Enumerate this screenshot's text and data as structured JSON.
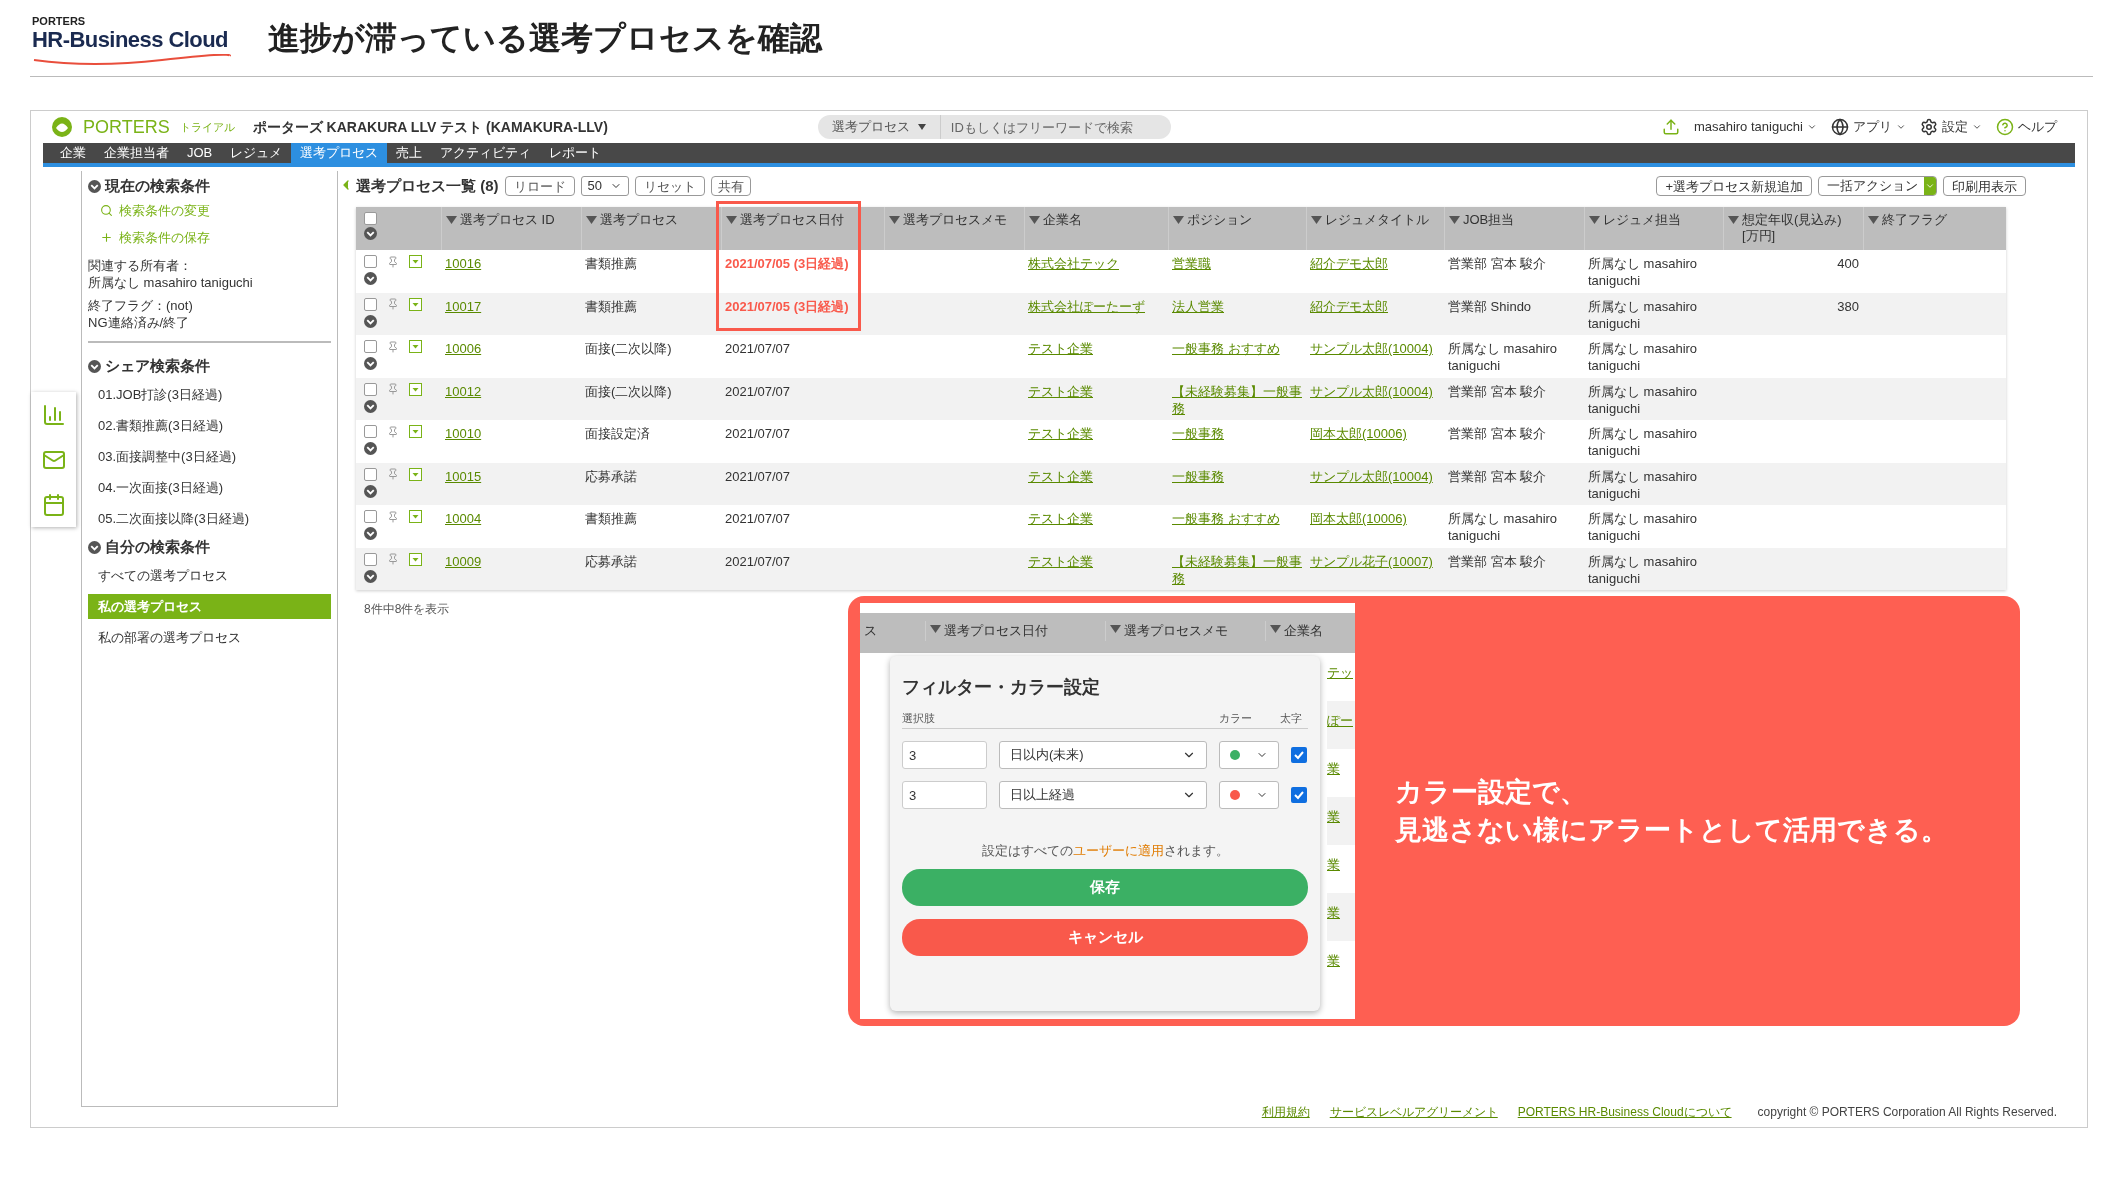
{
  "slide": {
    "logo_top": "PORTERS",
    "logo_main": "HR-Business Cloud",
    "title": "進捗が滞っている選考プロセスを確認"
  },
  "app": {
    "brand": "PORTERS",
    "trial": "トライアル",
    "account": "ポーターズ KARAKURA LLV テスト (KAMAKURA-LLV)",
    "search_scope": "選考プロセス",
    "search_placeholder": "IDもしくはフリーワードで検索",
    "user": "masahiro taniguchi",
    "menus": [
      {
        "kind": "apps",
        "label": "アプリ"
      },
      {
        "kind": "settings",
        "label": "設定"
      },
      {
        "kind": "help",
        "label": "ヘルプ"
      }
    ]
  },
  "nav": [
    {
      "label": "企業",
      "selected": false
    },
    {
      "label": "企業担当者",
      "selected": false
    },
    {
      "label": "JOB",
      "selected": false
    },
    {
      "label": "レジュメ",
      "selected": false
    },
    {
      "label": "選考プロセス",
      "selected": true
    },
    {
      "label": "売上",
      "selected": false
    },
    {
      "label": "アクティビティ",
      "selected": false
    },
    {
      "label": "レポート",
      "selected": false
    }
  ],
  "sidebar": {
    "current": {
      "heading": "現在の検索条件",
      "actions": [
        {
          "kind": "search",
          "label": "検索条件の変更"
        },
        {
          "kind": "add",
          "label": "検索条件の保存"
        }
      ],
      "conditions": [
        [
          "関連する所有者：",
          "所属なし masahiro taniguchi"
        ],
        [
          "終了フラグ：(not)",
          "NG連絡済み/終了"
        ]
      ]
    },
    "shared": {
      "heading": "シェア検索条件",
      "items": [
        {
          "label": "01.JOB打診(3日経過)",
          "selected": false
        },
        {
          "label": "02.書類推薦(3日経過)",
          "selected": false
        },
        {
          "label": "03.面接調整中(3日経過)",
          "selected": false
        },
        {
          "label": "04.一次面接(3日経過)",
          "selected": false
        },
        {
          "label": "05.二次面接以降(3日経過)",
          "selected": false
        }
      ]
    },
    "mine": {
      "heading": "自分の検索条件",
      "items": [
        {
          "label": "すべての選考プロセス",
          "selected": false
        },
        {
          "label": "私の選考プロセス",
          "selected": true
        },
        {
          "label": "私の部署の選考プロセス",
          "selected": false
        }
      ]
    }
  },
  "list": {
    "select_all_checked": false,
    "title": "選考プロセス一覧 (8)",
    "reload": "リロード",
    "page_size": "50",
    "reset": "リセット",
    "share": "共有",
    "add": "+選考プロセス新規追加",
    "bulk": "一括アクション",
    "print": "印刷用表示",
    "columns": [
      "選考プロセス ID",
      "選考プロセス",
      "選考プロセス日付",
      "選考プロセスメモ",
      "企業名",
      "ポジション",
      "レジュメタイトル",
      "JOB担当",
      "レジュメ担当",
      "想定年収(見込み)\n[万円]",
      "終了フラグ"
    ],
    "rows": [
      {
        "checked": false,
        "id": "10016",
        "process": "書類推薦",
        "date": "2021/07/05 (3日経過)",
        "alert": true,
        "company": "株式会社テック",
        "position": "営業職",
        "resume": "紹介デモ太郎",
        "job_owner": "営業部 宮本 駿介",
        "resume_owner": "所属なし masahiro taniguchi",
        "salary": "400"
      },
      {
        "checked": false,
        "id": "10017",
        "process": "書類推薦",
        "date": "2021/07/05 (3日経過)",
        "alert": true,
        "company": "株式会社ぽーたーず",
        "position": "法人営業",
        "resume": "紹介デモ太郎",
        "job_owner": "営業部 Shindo",
        "resume_owner": "所属なし masahiro taniguchi",
        "salary": "380"
      },
      {
        "checked": false,
        "id": "10006",
        "process": "面接(二次以降)",
        "date": "2021/07/07",
        "alert": false,
        "company": "テスト企業",
        "position": "一般事務 おすすめ",
        "resume": "サンプル太郎(10004)",
        "job_owner": "所属なし masahiro taniguchi",
        "resume_owner": "所属なし masahiro taniguchi"
      },
      {
        "checked": false,
        "id": "10012",
        "process": "面接(二次以降)",
        "date": "2021/07/07",
        "alert": false,
        "company": "テスト企業",
        "position": "【未経験募集】一般事務",
        "resume": "サンプル太郎(10004)",
        "job_owner": "営業部 宮本 駿介",
        "resume_owner": "所属なし masahiro taniguchi"
      },
      {
        "checked": false,
        "id": "10010",
        "process": "面接設定済",
        "date": "2021/07/07",
        "alert": false,
        "company": "テスト企業",
        "position": "一般事務",
        "resume": "岡本太郎(10006)",
        "job_owner": "営業部 宮本 駿介",
        "resume_owner": "所属なし masahiro taniguchi"
      },
      {
        "checked": false,
        "id": "10015",
        "process": "応募承諾",
        "date": "2021/07/07",
        "alert": false,
        "company": "テスト企業",
        "position": "一般事務",
        "resume": "サンプル太郎(10004)",
        "job_owner": "営業部 宮本 駿介",
        "resume_owner": "所属なし masahiro taniguchi"
      },
      {
        "checked": false,
        "id": "10004",
        "process": "書類推薦",
        "date": "2021/07/07",
        "alert": false,
        "company": "テスト企業",
        "position": "一般事務 おすすめ",
        "resume": "岡本太郎(10006)",
        "job_owner": "所属なし masahiro taniguchi",
        "resume_owner": "所属なし masahiro taniguchi"
      },
      {
        "checked": false,
        "id": "10009",
        "process": "応募承諾",
        "date": "2021/07/07",
        "alert": false,
        "company": "テスト企業",
        "position": "【未経験募集】一般事務",
        "resume": "サンプル花子(10007)",
        "job_owner": "営業部 宮本 駿介",
        "resume_owner": "所属なし masahiro taniguchi"
      }
    ],
    "count": "8件中8件を表示"
  },
  "callout": {
    "snippet_columns": [
      "ス",
      "選考プロセス日付",
      "選考プロセスメモ",
      "企業名"
    ],
    "snippet_cells": [
      "テッ",
      "ぽー",
      "業",
      "業",
      "業",
      "業",
      "業"
    ],
    "dialog": {
      "title": "フィルター・カラー設定",
      "col_option": "選択肢",
      "col_color": "カラー",
      "col_bold": "太字",
      "rules": [
        {
          "value": "3",
          "option": "日以内(未来)",
          "color": "#3bb064",
          "bold": true
        },
        {
          "value": "3",
          "option": "日以上経過",
          "color": "#f9594b",
          "bold": true
        }
      ],
      "note_before": "設定はすべての",
      "note_link": "ユーザーに適用",
      "note_after": "されます。",
      "save": "保存",
      "cancel": "キャンセル"
    },
    "message": [
      "カラー設定で、",
      "見逃さない様にアラートとして活用できる。"
    ]
  },
  "footer": {
    "links": [
      "利用規約",
      "サービスレベルアグリーメント",
      "PORTERS HR-Business Cloudについて"
    ],
    "copyright": "copyright © PORTERS Corporation All Rights Reserved."
  }
}
